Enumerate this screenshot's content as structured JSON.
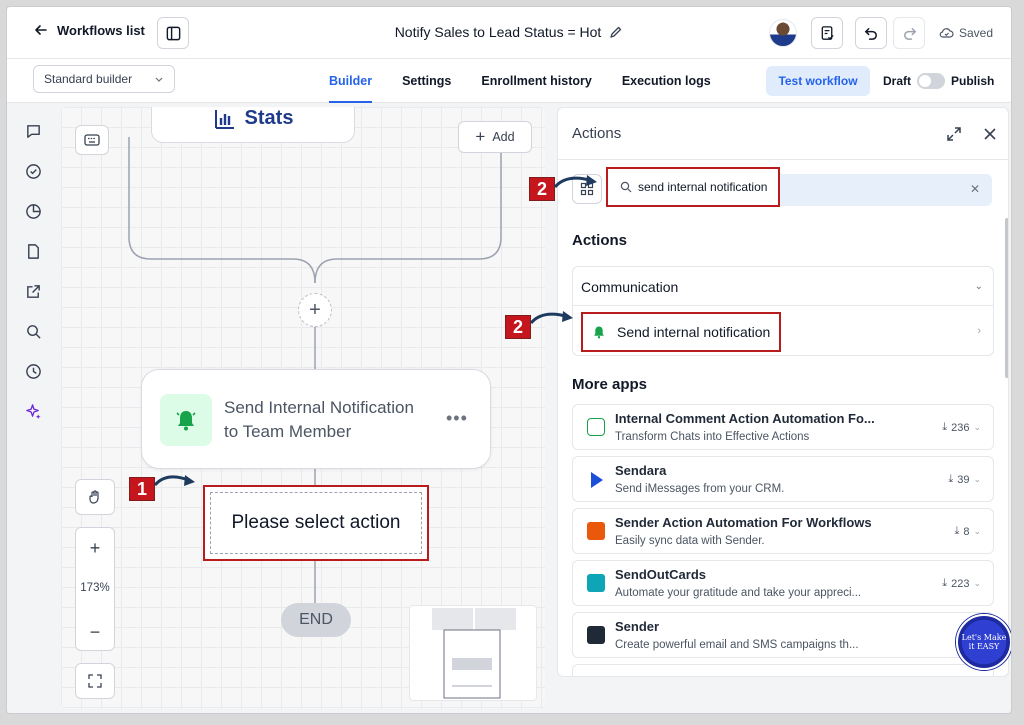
{
  "header": {
    "back_label": "Workflows list",
    "workflow_title": "Notify Sales to Lead Status = Hot",
    "saved_label": "Saved"
  },
  "subbar": {
    "builder_mode": "Standard builder",
    "tabs": [
      {
        "label": "Builder",
        "active": true
      },
      {
        "label": "Settings",
        "active": false
      },
      {
        "label": "Enrollment history",
        "active": false
      },
      {
        "label": "Execution logs",
        "active": false
      }
    ],
    "test_label": "Test workflow",
    "draft_label": "Draft",
    "publish_label": "Publish"
  },
  "canvas": {
    "stats_label": "Stats",
    "add_label": "Add",
    "node_title_line1": "Send Internal Notification",
    "node_title_line2": "to Team Member",
    "select_action_label": "Please select action",
    "end_label": "END",
    "zoom_level": "173%",
    "marker_1": "1"
  },
  "panel": {
    "title": "Actions",
    "search_value": "send internal notification",
    "marker_2": "2",
    "actions_heading": "Actions",
    "category_label": "Communication",
    "result_label": "Send internal notification",
    "more_apps_heading": "More apps",
    "apps": [
      {
        "name": "Internal Comment Action Automation Fo...",
        "desc": "Transform Chats into Effective Actions",
        "count": "236",
        "color": "#16a34a"
      },
      {
        "name": "Sendara",
        "desc": "Send iMessages from your CRM.",
        "count": "39",
        "color": "#1d4ed8"
      },
      {
        "name": "Sender Action Automation For Workflows",
        "desc": "Easily sync data with Sender.",
        "count": "8",
        "color": "#ea580c"
      },
      {
        "name": "SendOutCards",
        "desc": "Automate your gratitude and take your appreci...",
        "count": "223",
        "color": "#0ea5b7"
      },
      {
        "name": "Sender",
        "desc": "Create powerful email and SMS campaigns th...",
        "count": "",
        "color": "#1f2937"
      }
    ]
  },
  "brand_badge": "Let's Make it EASY"
}
